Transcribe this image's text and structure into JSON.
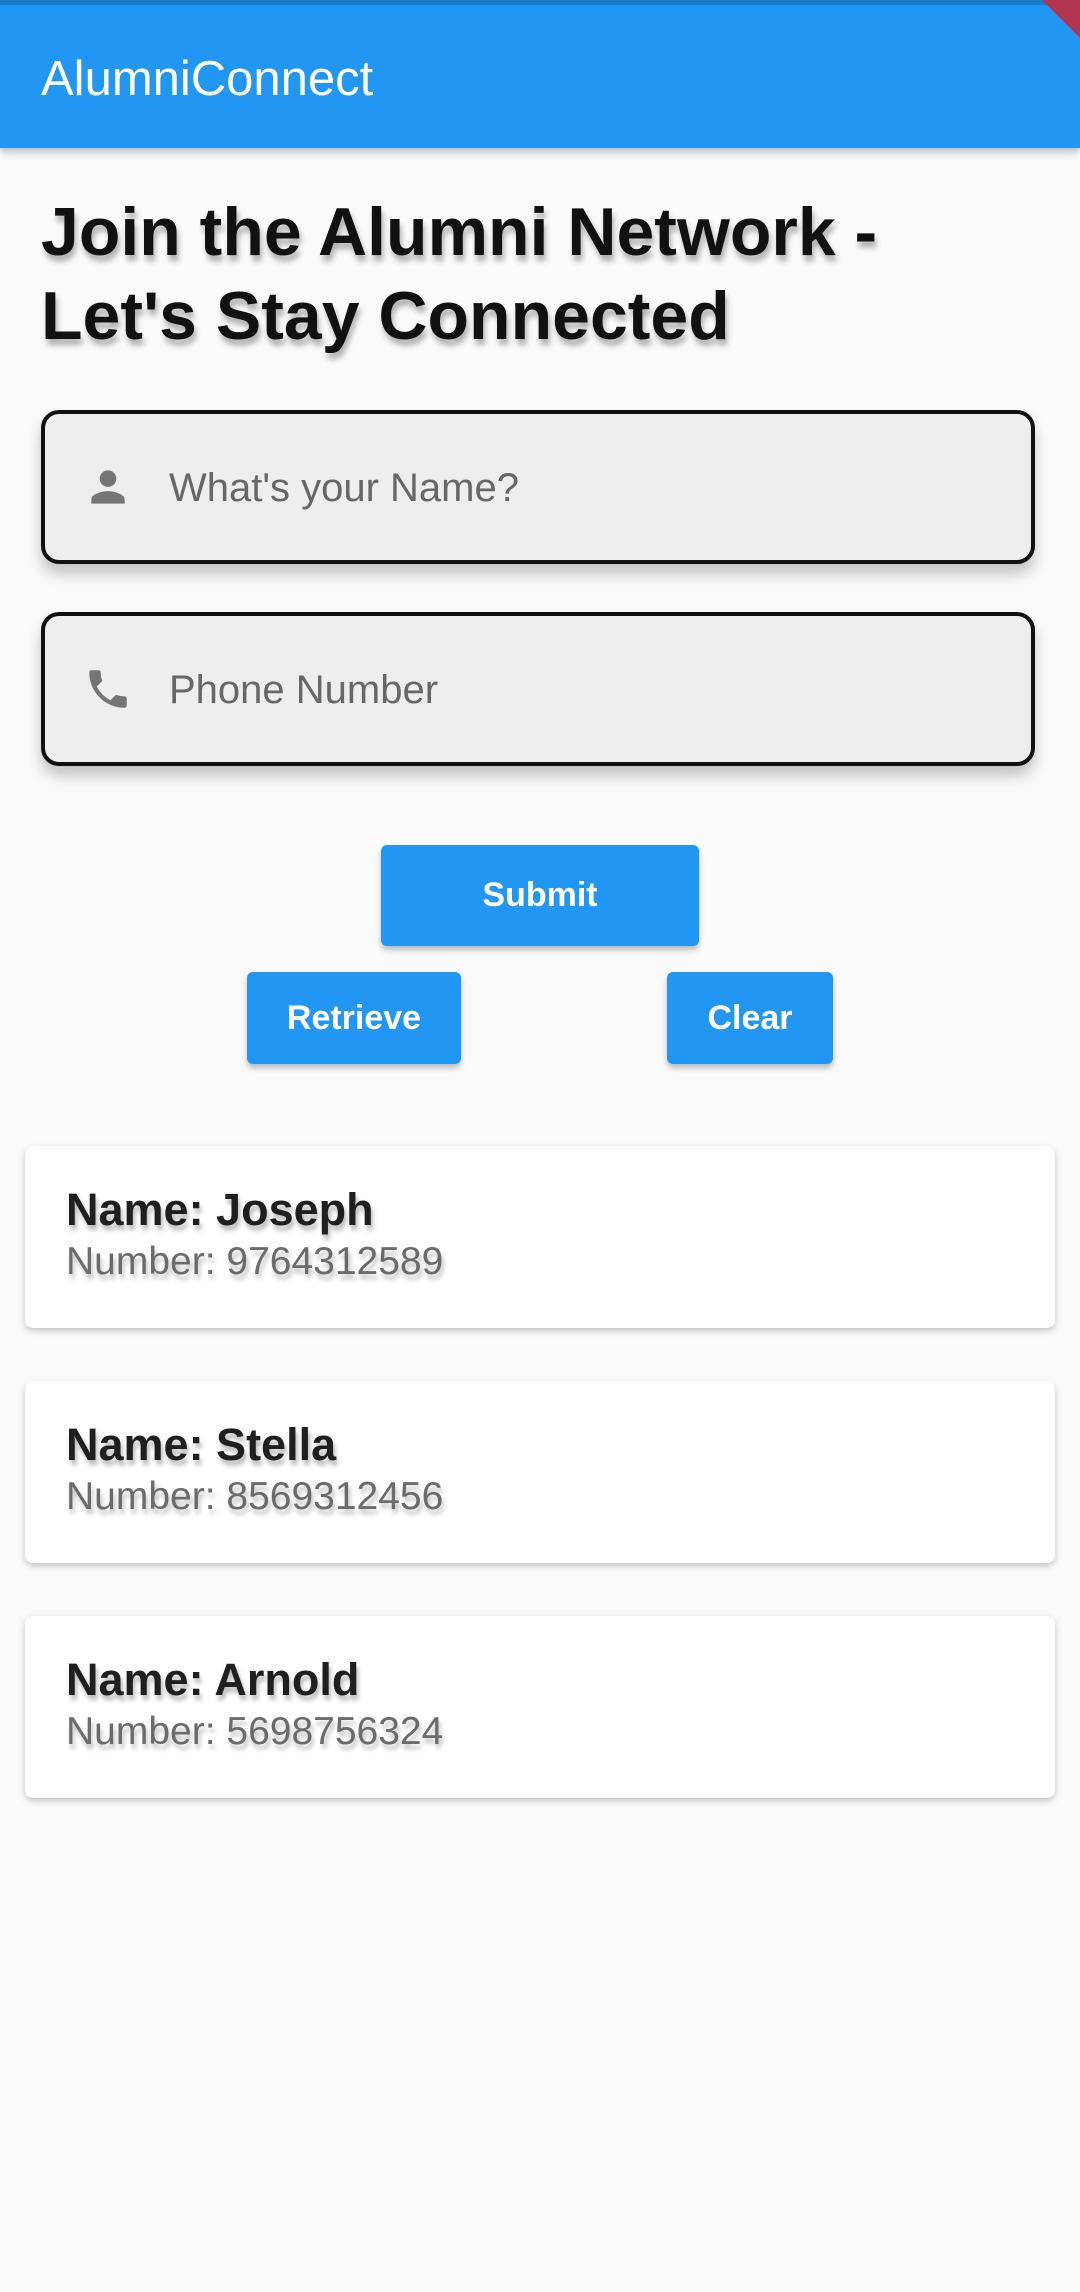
{
  "app": {
    "title": "AlumniConnect",
    "accent_color": "#2196f3"
  },
  "heading": "Join the Alumni Network - Let's Stay Connected",
  "form": {
    "name_field": {
      "icon": "person-icon",
      "placeholder": "What's your Name?",
      "value": ""
    },
    "phone_field": {
      "icon": "phone-icon",
      "placeholder": "Phone Number",
      "value": ""
    }
  },
  "buttons": {
    "submit": "Submit",
    "retrieve": "Retrieve",
    "clear": "Clear"
  },
  "alumni": [
    {
      "name": "Name: Joseph",
      "number": "Number: 9764312589"
    },
    {
      "name": "Name: Stella",
      "number": "Number: 8569312456"
    },
    {
      "name": "Name: Arnold",
      "number": "Number: 5698756324"
    }
  ]
}
